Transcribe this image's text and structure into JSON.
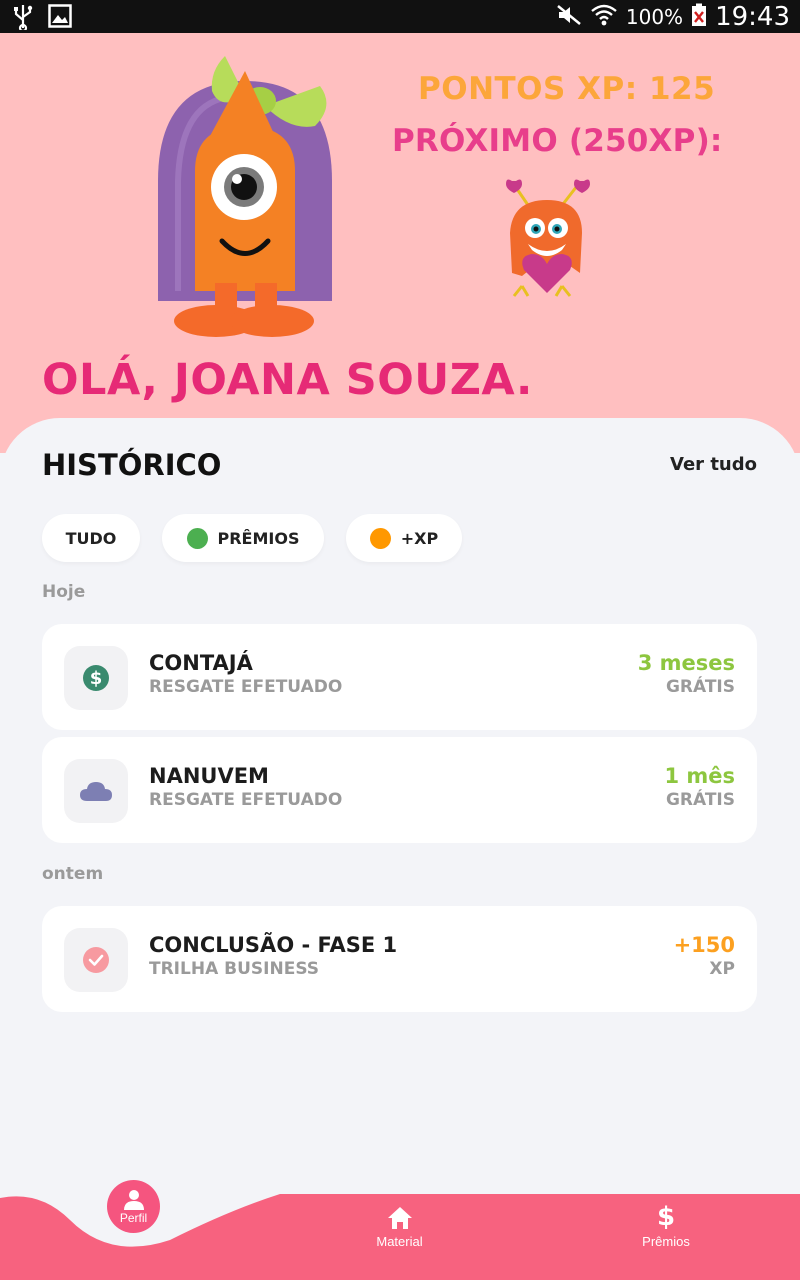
{
  "status_bar": {
    "battery": "100%",
    "time": "19:43"
  },
  "header": {
    "xp_points": "PONTOS XP: 125",
    "next_level": "PRÓXIMO (250XP):",
    "greeting": "OLÁ, JOANA SOUZA."
  },
  "history": {
    "title": "HISTÓRICO",
    "see_all": "Ver tudo",
    "filters": [
      {
        "label": "TUDO",
        "dot_color": ""
      },
      {
        "label": "PRÊMIOS",
        "dot_color": "#4caf50"
      },
      {
        "label": "+XP",
        "dot_color": "#ff9800"
      }
    ],
    "groups": [
      {
        "label": "Hoje",
        "items": [
          {
            "title": "CONTAJÁ",
            "subtitle": "RESGATE EFETUADO",
            "value": "3 meses",
            "unit": "GRÁTIS",
            "value_color": "#8dc63f",
            "icon": "dollar-circle-icon"
          },
          {
            "title": "NANUVEM",
            "subtitle": "RESGATE EFETUADO",
            "value": "1 mês",
            "unit": "GRÁTIS",
            "value_color": "#8dc63f",
            "icon": "cloud-icon"
          }
        ]
      },
      {
        "label": "ontem",
        "items": [
          {
            "title": "CONCLUSÃO - FASE 1",
            "subtitle": "TRILHA BUSINESS",
            "value": "+150",
            "unit": "XP",
            "value_color": "#fca020",
            "icon": "check-circle-icon"
          }
        ]
      }
    ]
  },
  "nav": {
    "profile": "Perfil",
    "material": "Material",
    "prizes": "Prêmios"
  },
  "colors": {
    "hero_bg": "#ffbfc0",
    "accent_pink": "#e62a76",
    "nav_bg": "#f7627f"
  }
}
